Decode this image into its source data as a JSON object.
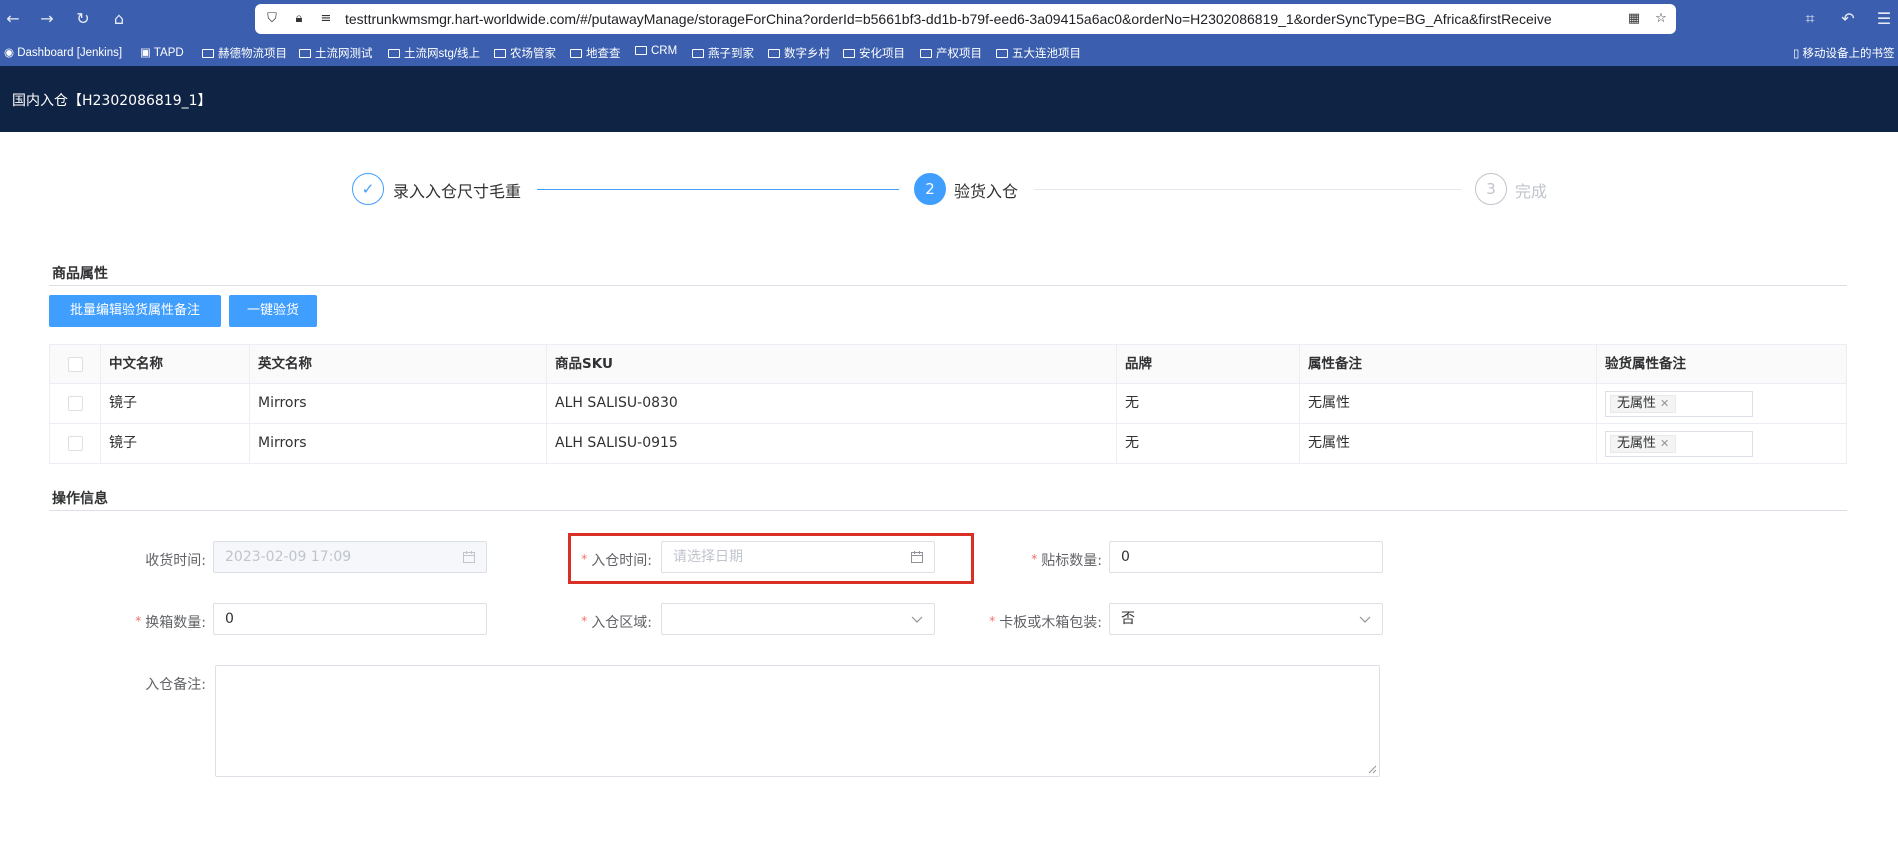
{
  "browser": {
    "url": "testtrunkwmsmgr.hart-worldwide.com/#/putawayManage/storageForChina?orderId=b5661bf3-dd1b-b79f-eed6-3a09415a6ac0&orderNo=H2302086819_1&orderSyncType=BG_Africa&firstReceive",
    "bookmarks": [
      "Dashboard [Jenkins]",
      "TAPD",
      "赫德物流项目",
      "土流网测试",
      "土流网stg/线上",
      "农场管家",
      "地查查",
      "CRM",
      "燕子到家",
      "数字乡村",
      "安化项目",
      "产权项目",
      "五大连池项目"
    ],
    "mobile_bookmarks": "移动设备上的书签"
  },
  "header": {
    "title": "国内入仓【H2302086819_1】"
  },
  "steps": [
    {
      "number": "✓",
      "label": "录入入仓尺寸毛重",
      "state": "done"
    },
    {
      "number": "2",
      "label": "验货入仓",
      "state": "active"
    },
    {
      "number": "3",
      "label": "完成",
      "state": "pending"
    }
  ],
  "goods_section": {
    "title": "商品属性",
    "batch_edit_label": "批量编辑验货属性备注",
    "one_click_label": "一键验货",
    "columns": [
      "中文名称",
      "英文名称",
      "商品SKU",
      "品牌",
      "属性备注",
      "验货属性备注"
    ],
    "rows": [
      {
        "cn_name": "镜子",
        "en_name": "Mirrors",
        "sku": "ALH SALISU-0830",
        "brand": "无",
        "attr_note": "无属性",
        "inspect_tag": "无属性"
      },
      {
        "cn_name": "镜子",
        "en_name": "Mirrors",
        "sku": "ALH SALISU-0915",
        "brand": "无",
        "attr_note": "无属性",
        "inspect_tag": "无属性"
      }
    ]
  },
  "ops_section": {
    "title": "操作信息",
    "receive_time_label": "收货时间:",
    "receive_time_value": "2023-02-09 17:09",
    "warehouse_time_label": "入仓时间:",
    "warehouse_time_placeholder": "请选择日期",
    "label_count_label": "贴标数量:",
    "label_count_value": "0",
    "box_change_label": "换箱数量:",
    "box_change_value": "0",
    "area_label": "入仓区域:",
    "area_value": "",
    "pallet_label": "卡板或木箱包装:",
    "pallet_value": "否",
    "remark_label": "入仓备注:",
    "remark_value": ""
  },
  "colors": {
    "primary": "#409eff",
    "header_bg": "#0f2345",
    "browser_bg": "#3b5fae",
    "highlight": "#d93025",
    "required": "#f56c6c"
  }
}
